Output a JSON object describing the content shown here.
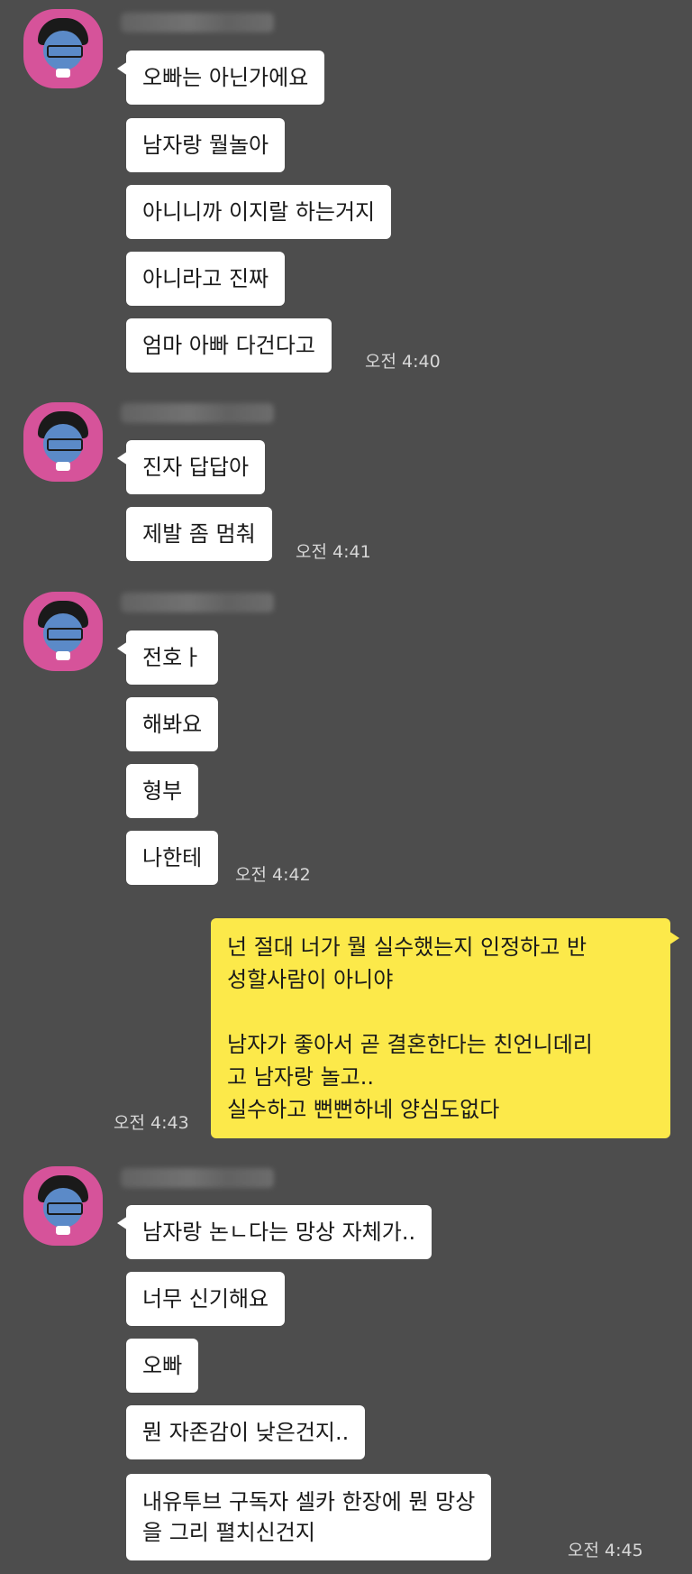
{
  "groups": [
    {
      "sender_name": "",
      "messages": [
        "오빠는 아닌가에요",
        "남자랑 뭘놀아",
        "아니니까 이지랄 하는거지",
        "아니라고 진짜",
        "엄마 아빠 다건다고"
      ],
      "time": "오전 4:40"
    },
    {
      "sender_name": "",
      "messages": [
        "진자 답답아",
        "제발 좀 멈춰"
      ],
      "time": "오전 4:41"
    },
    {
      "sender_name": "",
      "messages": [
        "전호ㅏ",
        "해봐요",
        "형부",
        "나한테"
      ],
      "time": "오전 4:42"
    },
    {
      "sender_name": "",
      "messages": [
        "남자랑 논ㄴ다는 망상 자체가..",
        "너무 신기해요",
        "오빠",
        "뭔 자존감이 낮은건지..",
        "내유투브 구독자 셀카 한장에 뭔 망상",
        "을 그리 펼치신건지"
      ],
      "time": "오전 4:45"
    }
  ],
  "my_message": {
    "lines": [
      "넌 절대 너가 뭘 실수했는지 인정하고 반",
      "성할사람이 아니야",
      "",
      "남자가 좋아서 곧 결혼한다는 친언니데리",
      "고 남자랑 놀고..",
      "실수하고 뻔뻔하네 양심도없다"
    ],
    "time": "오전 4:43"
  },
  "colors": {
    "background": "#4d4d4d",
    "incoming_bubble": "#ffffff",
    "outgoing_bubble": "#fce94a",
    "avatar_bg": "#d6539a",
    "timestamp": "#d8d8d8"
  },
  "icons": {
    "avatar": "profile-avatar-icon"
  }
}
